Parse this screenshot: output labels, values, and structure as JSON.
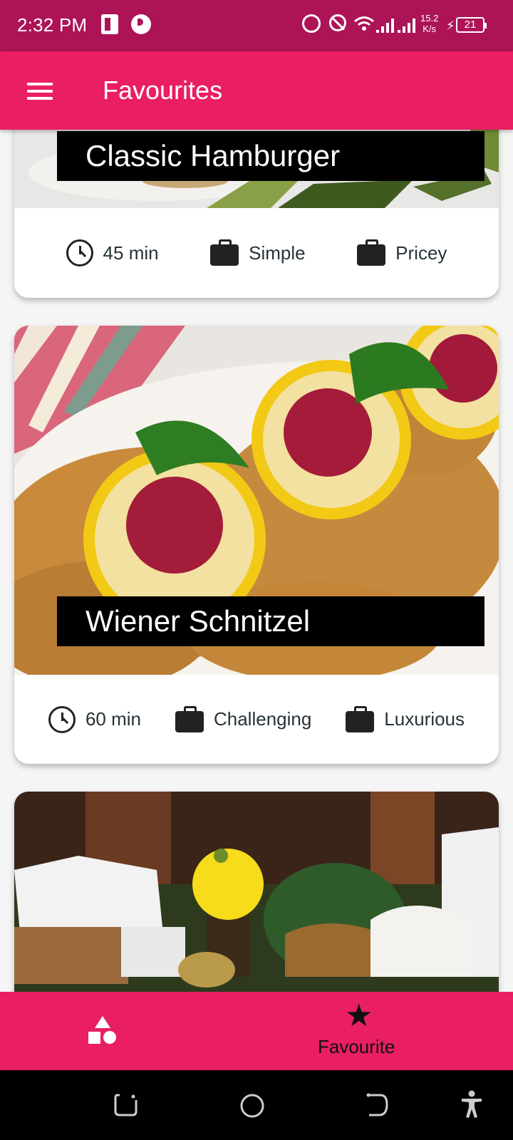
{
  "status_bar": {
    "time": "2:32 PM",
    "speed_top": "15.2",
    "speed_bottom": "K/s",
    "battery": "21",
    "icons": [
      "publisher-icon",
      "p-icon",
      "alarm-icon",
      "do-not-disturb-icon",
      "wifi-icon",
      "signal-icon",
      "signal-icon",
      "charging-icon",
      "battery-icon"
    ]
  },
  "app_bar": {
    "title": "Favourites",
    "menu_icon": "menu-icon"
  },
  "meals": [
    {
      "title": "Classic Hamburger",
      "duration": "45 min",
      "complexity": "Simple",
      "affordability": "Pricey"
    },
    {
      "title": "Wiener Schnitzel",
      "duration": "60 min",
      "complexity": "Challenging",
      "affordability": "Luxurious"
    },
    {
      "title": "",
      "partially_visible": true
    }
  ],
  "bottom_nav": {
    "categories_icon": "category-icon",
    "favourite_label": "Favourite",
    "favourite_icon": "star-icon"
  },
  "system_nav": [
    "recents-icon",
    "home-icon",
    "back-icon",
    "accessibility-icon"
  ]
}
